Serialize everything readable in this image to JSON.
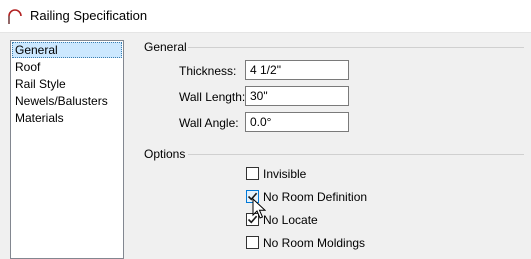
{
  "window": {
    "title": "Railing Specification",
    "icon": "railing-arc-icon"
  },
  "nav": {
    "items": [
      {
        "label": "General",
        "selected": true
      },
      {
        "label": "Roof",
        "selected": false
      },
      {
        "label": "Rail Style",
        "selected": false
      },
      {
        "label": "Newels/Balusters",
        "selected": false
      },
      {
        "label": "Materials",
        "selected": false
      }
    ]
  },
  "general": {
    "heading": "General",
    "fields": [
      {
        "label": "Thickness:",
        "value": "4 1/2\""
      },
      {
        "label": "Wall Length:",
        "value": "30\""
      },
      {
        "label": "Wall Angle:",
        "value": "0.0°"
      }
    ]
  },
  "options": {
    "heading": "Options",
    "checkboxes": [
      {
        "label": "Invisible",
        "checked": false
      },
      {
        "label": "No Room Definition",
        "checked": true
      },
      {
        "label": "No Locate",
        "checked": true
      },
      {
        "label": "No Room Moldings",
        "checked": false
      }
    ]
  },
  "colors": {
    "accent": "#0078d7",
    "selection": "#cce8ff",
    "arc_icon": "#b22222"
  }
}
